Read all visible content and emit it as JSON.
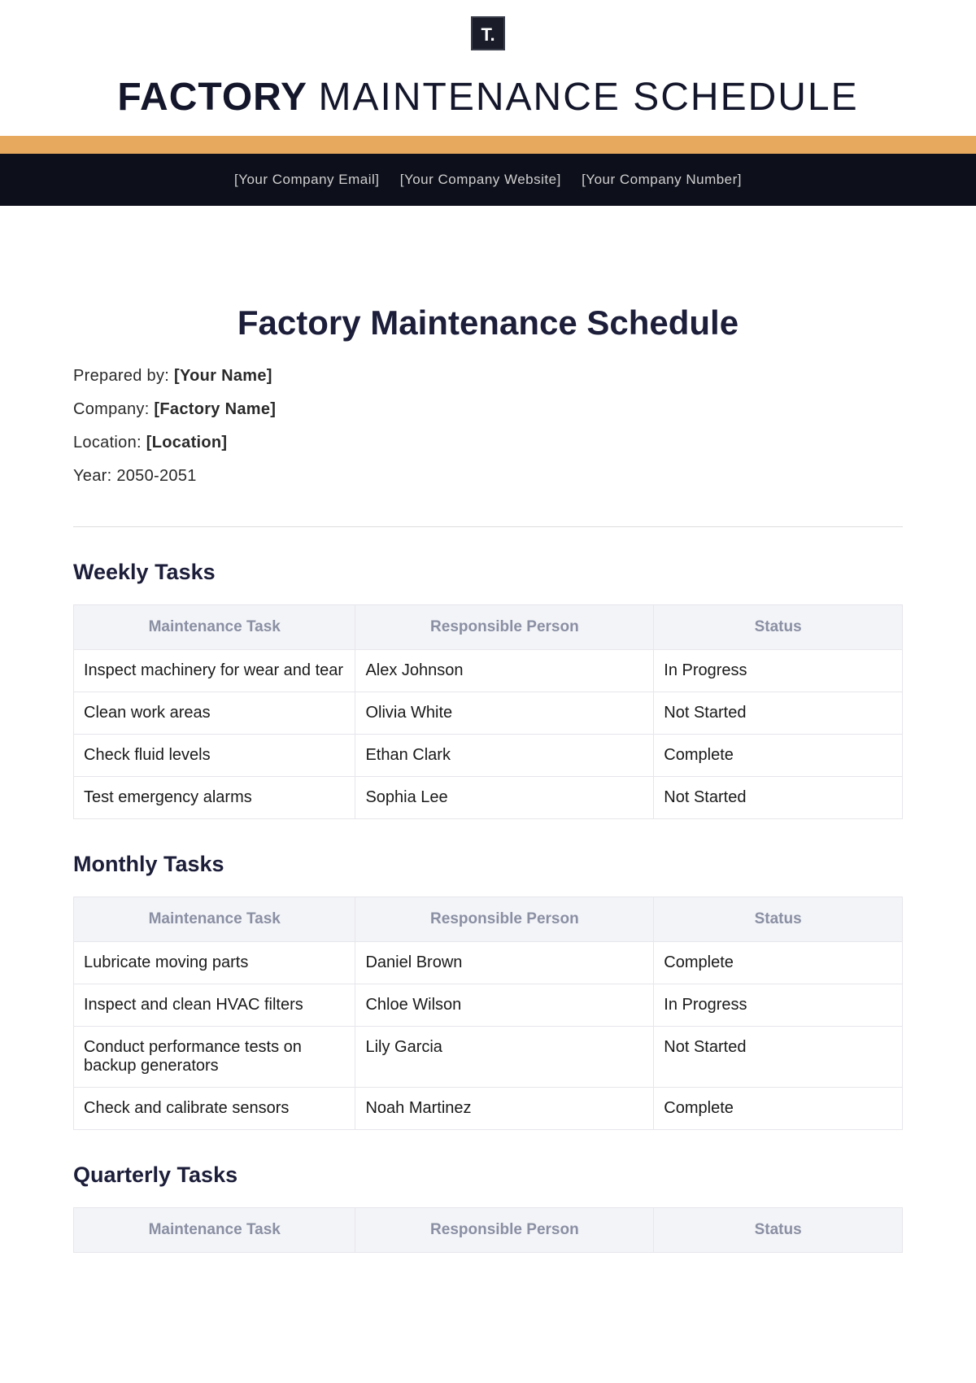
{
  "logo_text": "T.",
  "header": {
    "title_bold": "FACTORY",
    "title_light": "MAINTENANCE SCHEDULE"
  },
  "contact_bar": {
    "email": "[Your Company Email]",
    "website": "[Your Company Website]",
    "number": "[Your Company Number]"
  },
  "doc_title": "Factory Maintenance Schedule",
  "meta": {
    "prepared_label": "Prepared by:",
    "prepared_value": "[Your Name]",
    "company_label": "Company:",
    "company_value": "[Factory Name]",
    "location_label": "Location:",
    "location_value": "[Location]",
    "year_label": "Year:",
    "year_value": "2050-2051"
  },
  "columns": {
    "task": "Maintenance Task",
    "person": "Responsible Person",
    "status": "Status"
  },
  "sections": {
    "weekly": {
      "title": "Weekly Tasks",
      "rows": [
        {
          "task": "Inspect machinery for wear and tear",
          "person": "Alex Johnson",
          "status": "In Progress"
        },
        {
          "task": "Clean work areas",
          "person": "Olivia White",
          "status": "Not Started"
        },
        {
          "task": "Check fluid levels",
          "person": "Ethan Clark",
          "status": "Complete"
        },
        {
          "task": "Test emergency alarms",
          "person": "Sophia Lee",
          "status": "Not Started"
        }
      ]
    },
    "monthly": {
      "title": "Monthly Tasks",
      "rows": [
        {
          "task": "Lubricate moving parts",
          "person": "Daniel Brown",
          "status": "Complete"
        },
        {
          "task": "Inspect and clean HVAC filters",
          "person": "Chloe Wilson",
          "status": "In Progress"
        },
        {
          "task": "Conduct performance tests on backup generators",
          "person": "Lily Garcia",
          "status": "Not Started"
        },
        {
          "task": "Check and calibrate sensors",
          "person": "Noah Martinez",
          "status": "Complete"
        }
      ]
    },
    "quarterly": {
      "title": "Quarterly Tasks"
    }
  }
}
